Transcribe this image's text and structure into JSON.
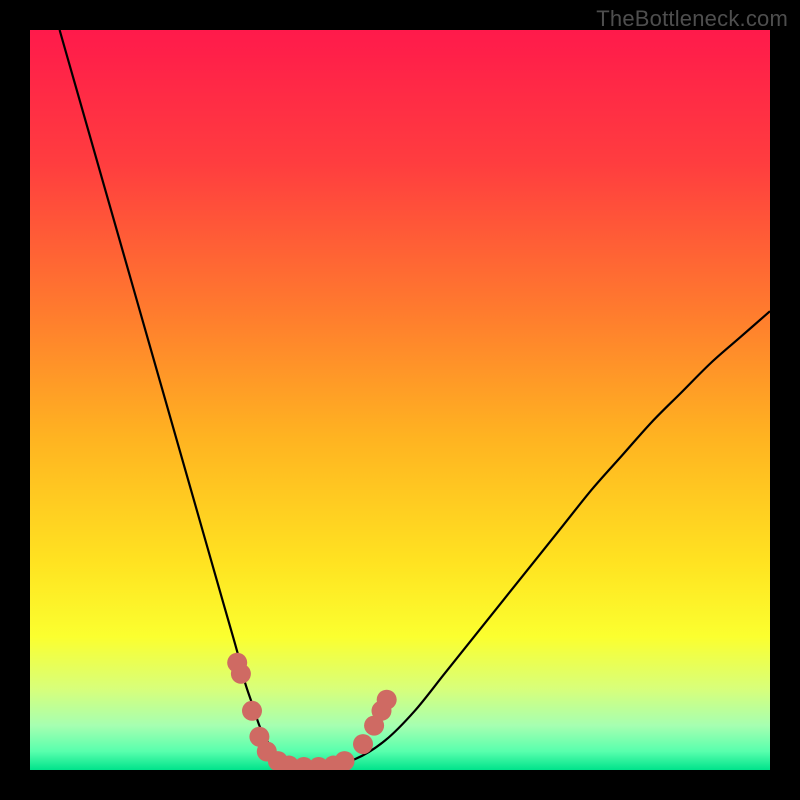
{
  "watermark": "TheBottleneck.com",
  "colors": {
    "black": "#000000",
    "curve": "#000000",
    "marker_fill": "#cf6a63",
    "gradient_stops": [
      {
        "offset": 0.0,
        "color": "#ff1a4b"
      },
      {
        "offset": 0.18,
        "color": "#ff3d3f"
      },
      {
        "offset": 0.38,
        "color": "#ff7b2e"
      },
      {
        "offset": 0.55,
        "color": "#ffb321"
      },
      {
        "offset": 0.72,
        "color": "#ffe321"
      },
      {
        "offset": 0.82,
        "color": "#fbff2f"
      },
      {
        "offset": 0.89,
        "color": "#d8ff7a"
      },
      {
        "offset": 0.94,
        "color": "#a6ffb1"
      },
      {
        "offset": 0.975,
        "color": "#58ffad"
      },
      {
        "offset": 1.0,
        "color": "#00e38b"
      }
    ]
  },
  "chart_data": {
    "type": "line",
    "title": "",
    "xlabel": "",
    "ylabel": "",
    "xlim": [
      0,
      100
    ],
    "ylim": [
      0,
      100
    ],
    "series": [
      {
        "name": "bottleneck-curve",
        "x": [
          4,
          6,
          8,
          10,
          12,
          14,
          16,
          18,
          20,
          22,
          24,
          26,
          28,
          29,
          30,
          31,
          32,
          33,
          34,
          35,
          37,
          40,
          44,
          48,
          52,
          56,
          60,
          64,
          68,
          72,
          76,
          80,
          84,
          88,
          92,
          96,
          100
        ],
        "y": [
          100,
          93,
          86,
          79,
          72,
          65,
          58,
          51,
          44,
          37,
          30,
          23,
          16,
          12,
          9,
          6,
          4,
          2.5,
          1.5,
          1,
          0.5,
          0.5,
          1.5,
          4,
          8,
          13,
          18,
          23,
          28,
          33,
          38,
          42.5,
          47,
          51,
          55,
          58.5,
          62
        ]
      }
    ],
    "markers": {
      "name": "highlight-dots",
      "points": [
        {
          "x": 28.0,
          "y": 14.5
        },
        {
          "x": 28.5,
          "y": 13.0
        },
        {
          "x": 30.0,
          "y": 8.0
        },
        {
          "x": 31.0,
          "y": 4.5
        },
        {
          "x": 32.0,
          "y": 2.5
        },
        {
          "x": 33.5,
          "y": 1.2
        },
        {
          "x": 35.0,
          "y": 0.6
        },
        {
          "x": 37.0,
          "y": 0.4
        },
        {
          "x": 39.0,
          "y": 0.4
        },
        {
          "x": 41.0,
          "y": 0.6
        },
        {
          "x": 42.5,
          "y": 1.2
        },
        {
          "x": 45.0,
          "y": 3.5
        },
        {
          "x": 46.5,
          "y": 6.0
        },
        {
          "x": 47.5,
          "y": 8.0
        },
        {
          "x": 48.2,
          "y": 9.5
        }
      ]
    }
  }
}
